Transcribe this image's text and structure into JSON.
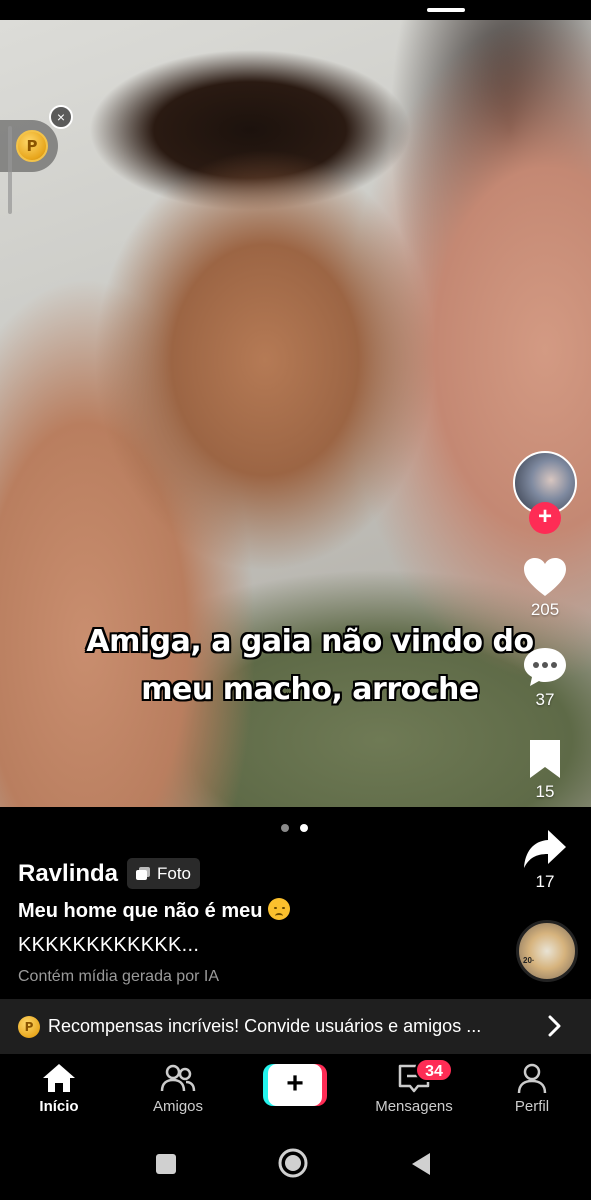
{
  "post": {
    "caption_line1": "Amiga, a gaia não vindo do",
    "caption_line2": "meu macho, arroche",
    "username": "Ravlinda",
    "tag_label": "Foto",
    "description": "Meu home que não é meu",
    "description_emoji": "disappointed-face",
    "description_more": "KKKKKKKKKKKK...",
    "ai_notice": "Contém mídia gerada por IA",
    "carousel_total": 2,
    "carousel_active": 2
  },
  "actions": {
    "likes": "205",
    "comments": "37",
    "saves": "15",
    "shares": "17"
  },
  "coin_widget": {
    "coin_symbol": "P",
    "close_symbol": "×"
  },
  "music_disc": {
    "label": "20·"
  },
  "promo": {
    "coin_symbol": "P",
    "text": "Recompensas incríveis! Convide usuários e amigos ..."
  },
  "nav": {
    "home": "Início",
    "friends": "Amigos",
    "create": "+",
    "messages": "Mensagens",
    "messages_badge": "34",
    "profile": "Perfil"
  },
  "colors": {
    "accent": "#fe2c55",
    "cyan": "#25f4ee",
    "promo_bg": "#1f1f1f",
    "muted_text": "#9a9a9a"
  }
}
